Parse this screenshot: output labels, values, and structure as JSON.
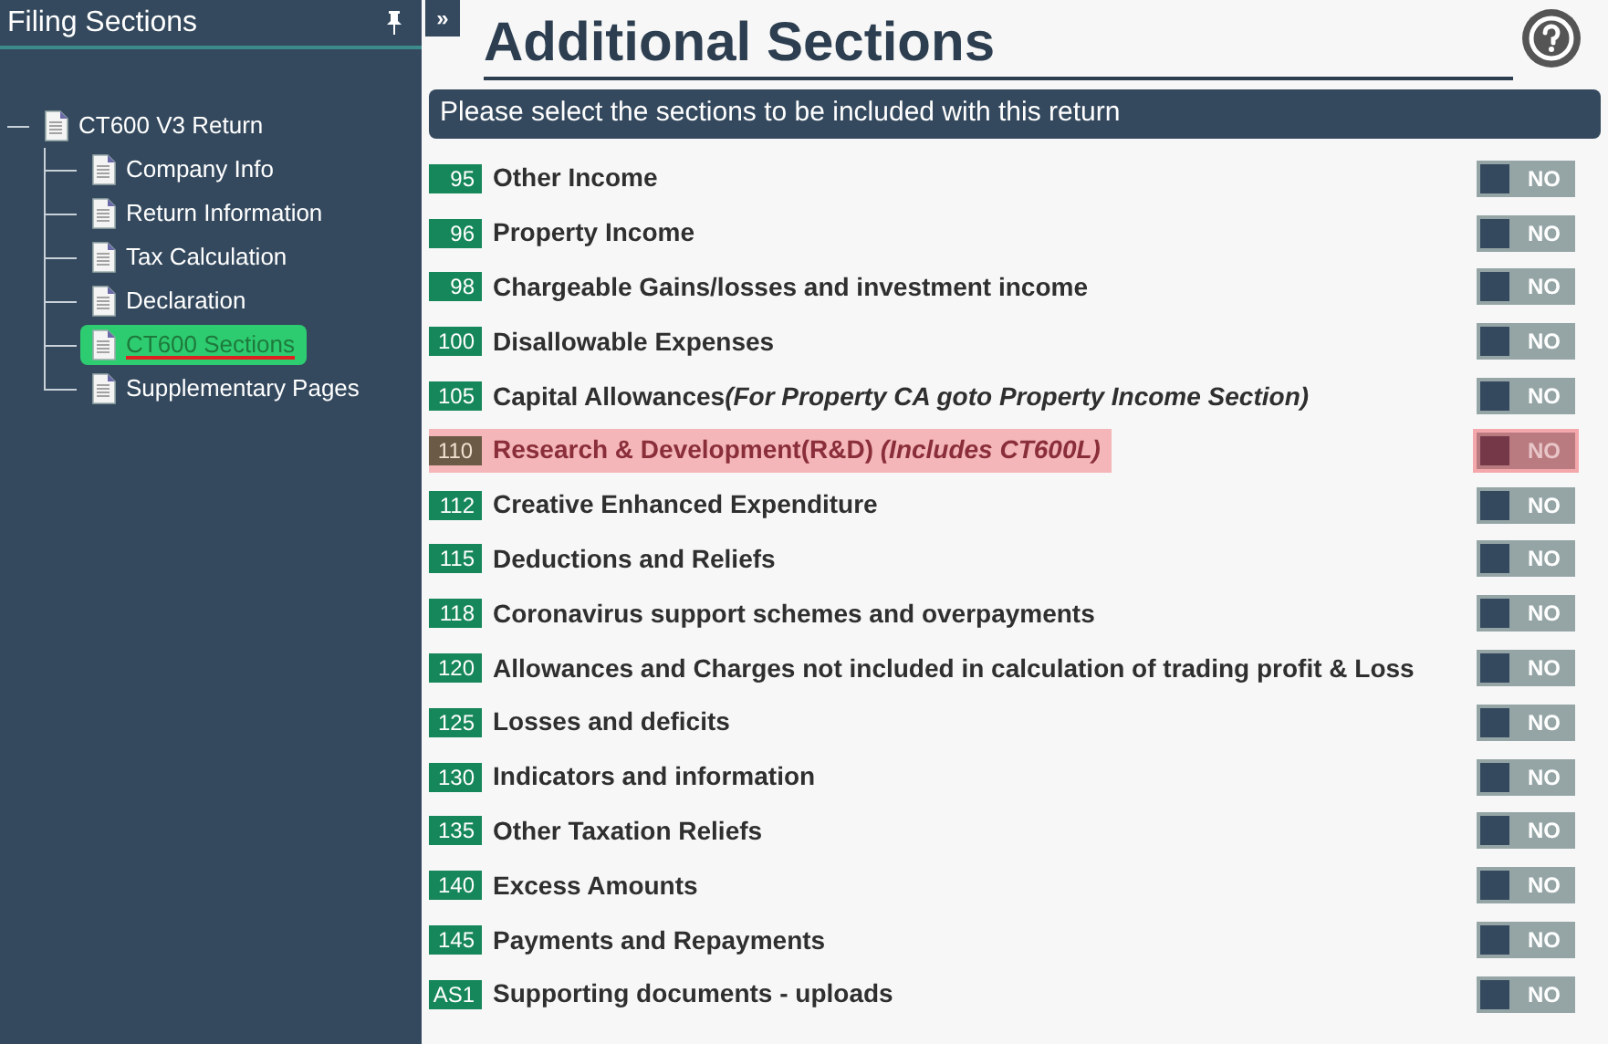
{
  "sidebar": {
    "title": "Filing Sections",
    "pin_button": {
      "kind": "pin"
    },
    "tree": [
      {
        "label": "CT600 V3 Return",
        "selected": false,
        "children": [
          {
            "label": "Company Info",
            "selected": false
          },
          {
            "label": "Return Information",
            "selected": false
          },
          {
            "label": "Tax Calculation",
            "selected": false
          },
          {
            "label": "Declaration",
            "selected": false
          },
          {
            "label": "CT600 Sections",
            "selected": true
          },
          {
            "label": "Supplementary Pages",
            "selected": false
          }
        ]
      }
    ]
  },
  "expand_button": "»",
  "page": {
    "title": "Additional Sections",
    "banner": "Please select the sections to be included with this return",
    "sections": [
      {
        "code": "95",
        "label": "Other Income",
        "toggle": "NO",
        "on": false,
        "highlighted": false
      },
      {
        "code": "96",
        "label": "Property Income",
        "toggle": "NO",
        "on": false,
        "highlighted": false
      },
      {
        "code": "98",
        "label": "Chargeable Gains/losses and investment income",
        "toggle": "NO",
        "on": false,
        "highlighted": false
      },
      {
        "code": "100",
        "label": "Disallowable Expenses",
        "toggle": "NO",
        "on": false,
        "highlighted": false
      },
      {
        "code": "105",
        "label": "Capital Allowances",
        "note": "(For Property CA goto Property Income Section)",
        "toggle": "NO",
        "on": false,
        "highlighted": false
      },
      {
        "code": "110",
        "label": "Research & Development(R&D) ",
        "note": "(Includes CT600L)",
        "toggle": "NO",
        "on": false,
        "highlighted": true
      },
      {
        "code": "112",
        "label": "Creative Enhanced Expenditure",
        "toggle": "NO",
        "on": false,
        "highlighted": false
      },
      {
        "code": "115",
        "label": "Deductions and Reliefs",
        "toggle": "NO",
        "on": false,
        "highlighted": false
      },
      {
        "code": "118",
        "label": "Coronavirus support schemes and overpayments",
        "toggle": "NO",
        "on": false,
        "highlighted": false
      },
      {
        "code": "120",
        "label": "Allowances and Charges not included in calculation of trading profit & Loss",
        "toggle": "NO",
        "on": false,
        "highlighted": false
      },
      {
        "code": "125",
        "label": "Losses and deficits",
        "toggle": "NO",
        "on": false,
        "highlighted": false
      },
      {
        "code": "130",
        "label": "Indicators and information",
        "toggle": "NO",
        "on": false,
        "highlighted": false
      },
      {
        "code": "135",
        "label": "Other Taxation Reliefs",
        "toggle": "NO",
        "on": false,
        "highlighted": false
      },
      {
        "code": "140",
        "label": "Excess Amounts",
        "toggle": "NO",
        "on": false,
        "highlighted": false
      },
      {
        "code": "145",
        "label": "Payments and Repayments",
        "toggle": "NO",
        "on": false,
        "highlighted": false
      },
      {
        "code": "AS1",
        "label": "Supporting documents - uploads",
        "toggle": "NO",
        "on": false,
        "highlighted": false
      }
    ]
  }
}
